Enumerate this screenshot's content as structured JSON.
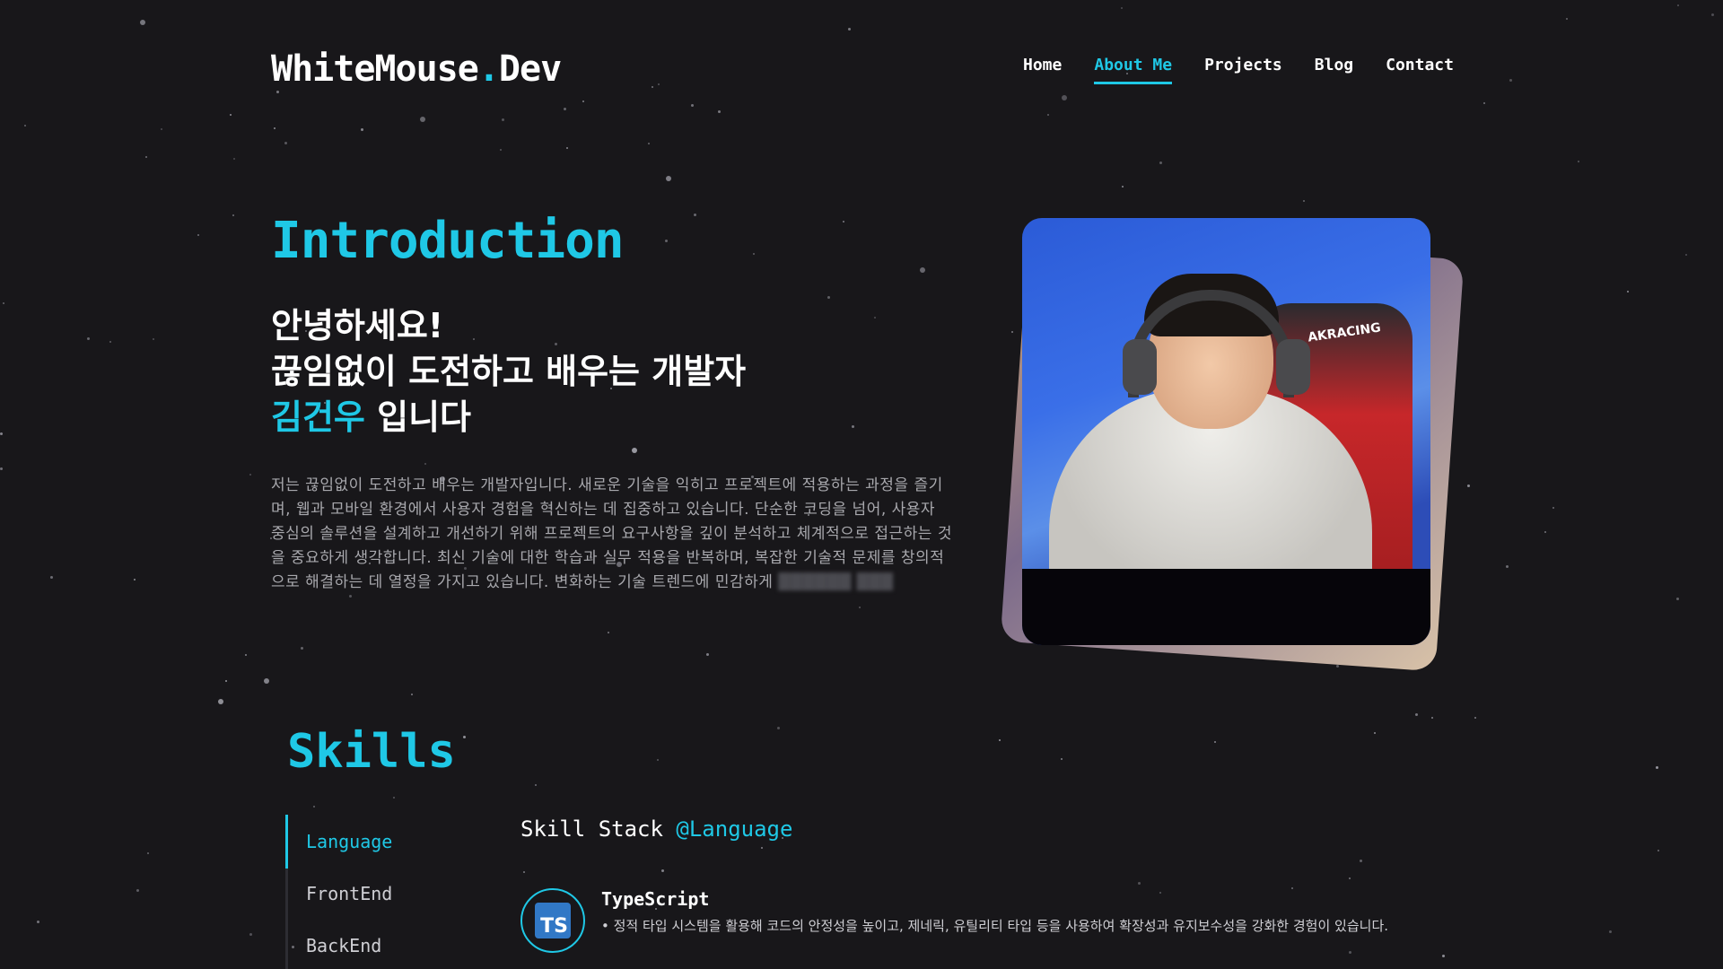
{
  "header": {
    "logo_main": "WhiteMouse",
    "logo_dot": ".",
    "logo_suffix": "Dev",
    "nav": [
      {
        "label": "Home"
      },
      {
        "label": "About Me",
        "active": true
      },
      {
        "label": "Projects"
      },
      {
        "label": "Blog"
      },
      {
        "label": "Contact"
      }
    ]
  },
  "intro": {
    "title": "Introduction",
    "greeting_line1": "안녕하세요!",
    "greeting_line2": "끊임없이 도전하고 배우는 개발자",
    "greeting_name": "김건우",
    "greeting_suffix": " 입니다",
    "description": "저는 끊임없이 도전하고 배우는 개발자입니다. 새로운 기술을 익히고 프로젝트에 적용하는 과정을 즐기며, 웹과 모바일 환경에서 사용자 경험을 혁신하는 데 집중하고 있습니다. 단순한 코딩을 넘어, 사용자 중심의 솔루션을 설계하고 개선하기 위해 프로젝트의 요구사항을 깊이 분석하고 체계적으로 접근하는 것을 중요하게 생각합니다. 최신 기술에 대한 학습과 실무 적용을 반복하며, 복잡한 기술적 문제를 창의적으로 해결하는 데 열정을 가지고 있습니다. 변화하는 기술 트렌드에 민감하게",
    "photo_chair_text": "AKRACING"
  },
  "skills": {
    "title": "Skills",
    "tabs": [
      {
        "label": "Language",
        "active": true
      },
      {
        "label": "FrontEnd"
      },
      {
        "label": "BackEnd"
      }
    ],
    "stack_heading": "Skill Stack ",
    "stack_category": "@Language",
    "items": [
      {
        "badge": "TS",
        "name": "TypeScript",
        "description": "• 정적 타입 시스템을 활용해 코드의 안정성을 높이고, 제네릭, 유틸리티 타입 등을 사용하여 확장성과 유지보수성을 강화한 경험이 있습니다."
      }
    ]
  },
  "colors": {
    "accent": "#1fc8e6",
    "background": "#18171a",
    "muted_text": "#a8a8ad"
  }
}
